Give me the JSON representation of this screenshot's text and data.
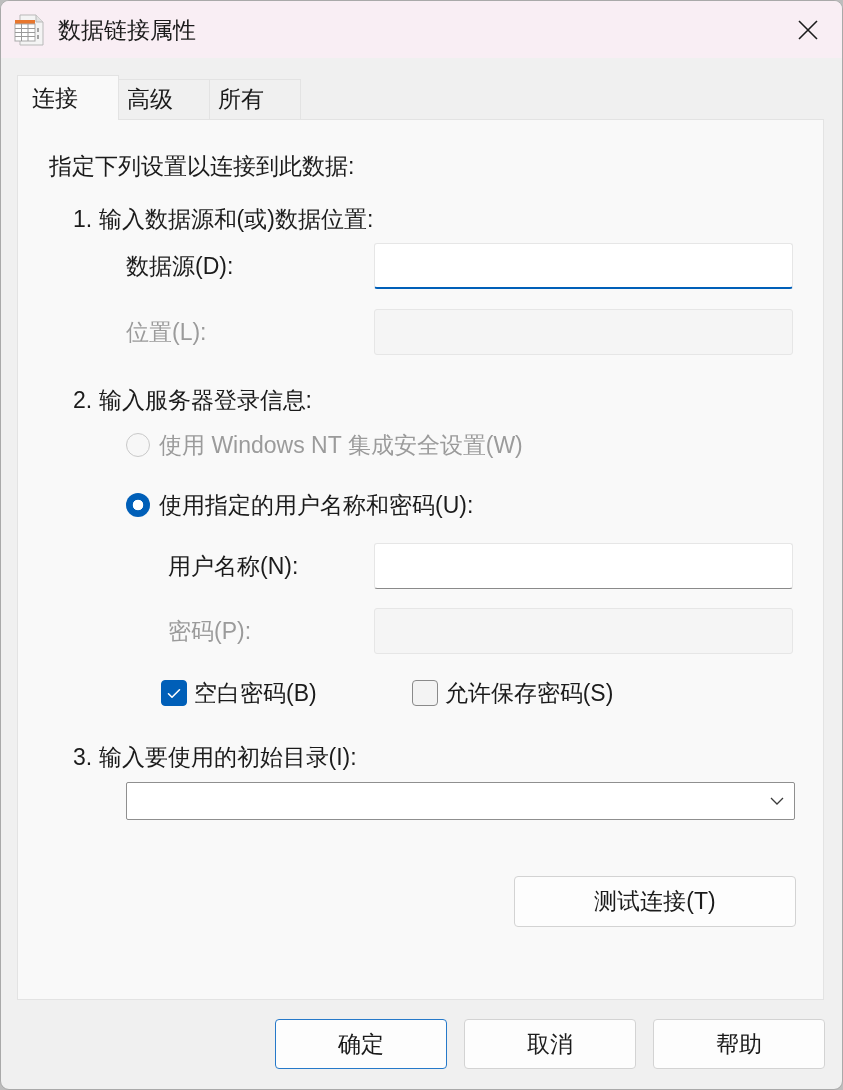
{
  "window": {
    "title": "数据链接属性"
  },
  "tabs": [
    {
      "label": "连接",
      "selected": true
    },
    {
      "label": "高级",
      "selected": false
    },
    {
      "label": "所有",
      "selected": false
    }
  ],
  "intro": "指定下列设置以连接到此数据:",
  "step1": {
    "heading": "1. 输入数据源和(或)数据位置:",
    "fields": [
      {
        "label": "数据源(D):",
        "disabled": false,
        "focused": true
      },
      {
        "label": "位置(L):",
        "disabled": true,
        "focused": false
      }
    ]
  },
  "step2": {
    "heading": "2. 输入服务器登录信息:",
    "radios": [
      {
        "label": "使用 Windows NT 集成安全设置(W)",
        "selected": false,
        "disabled": true
      },
      {
        "label": "使用指定的用户名称和密码(U):",
        "selected": true,
        "disabled": false
      }
    ],
    "fields": [
      {
        "label": "用户名称(N):",
        "disabled": false,
        "focused": false
      },
      {
        "label": "密码(P):",
        "disabled": true,
        "focused": false
      }
    ],
    "checkboxes": [
      {
        "label": "空白密码(B)",
        "checked": true
      },
      {
        "label": "允许保存密码(S)",
        "checked": false
      }
    ]
  },
  "step3": {
    "heading": "3. 输入要使用的初始目录(I):"
  },
  "test_button": "测试连接(T)",
  "buttons": [
    {
      "label": "确定",
      "default": true
    },
    {
      "label": "取消",
      "default": false
    },
    {
      "label": "帮助",
      "default": false
    }
  ]
}
